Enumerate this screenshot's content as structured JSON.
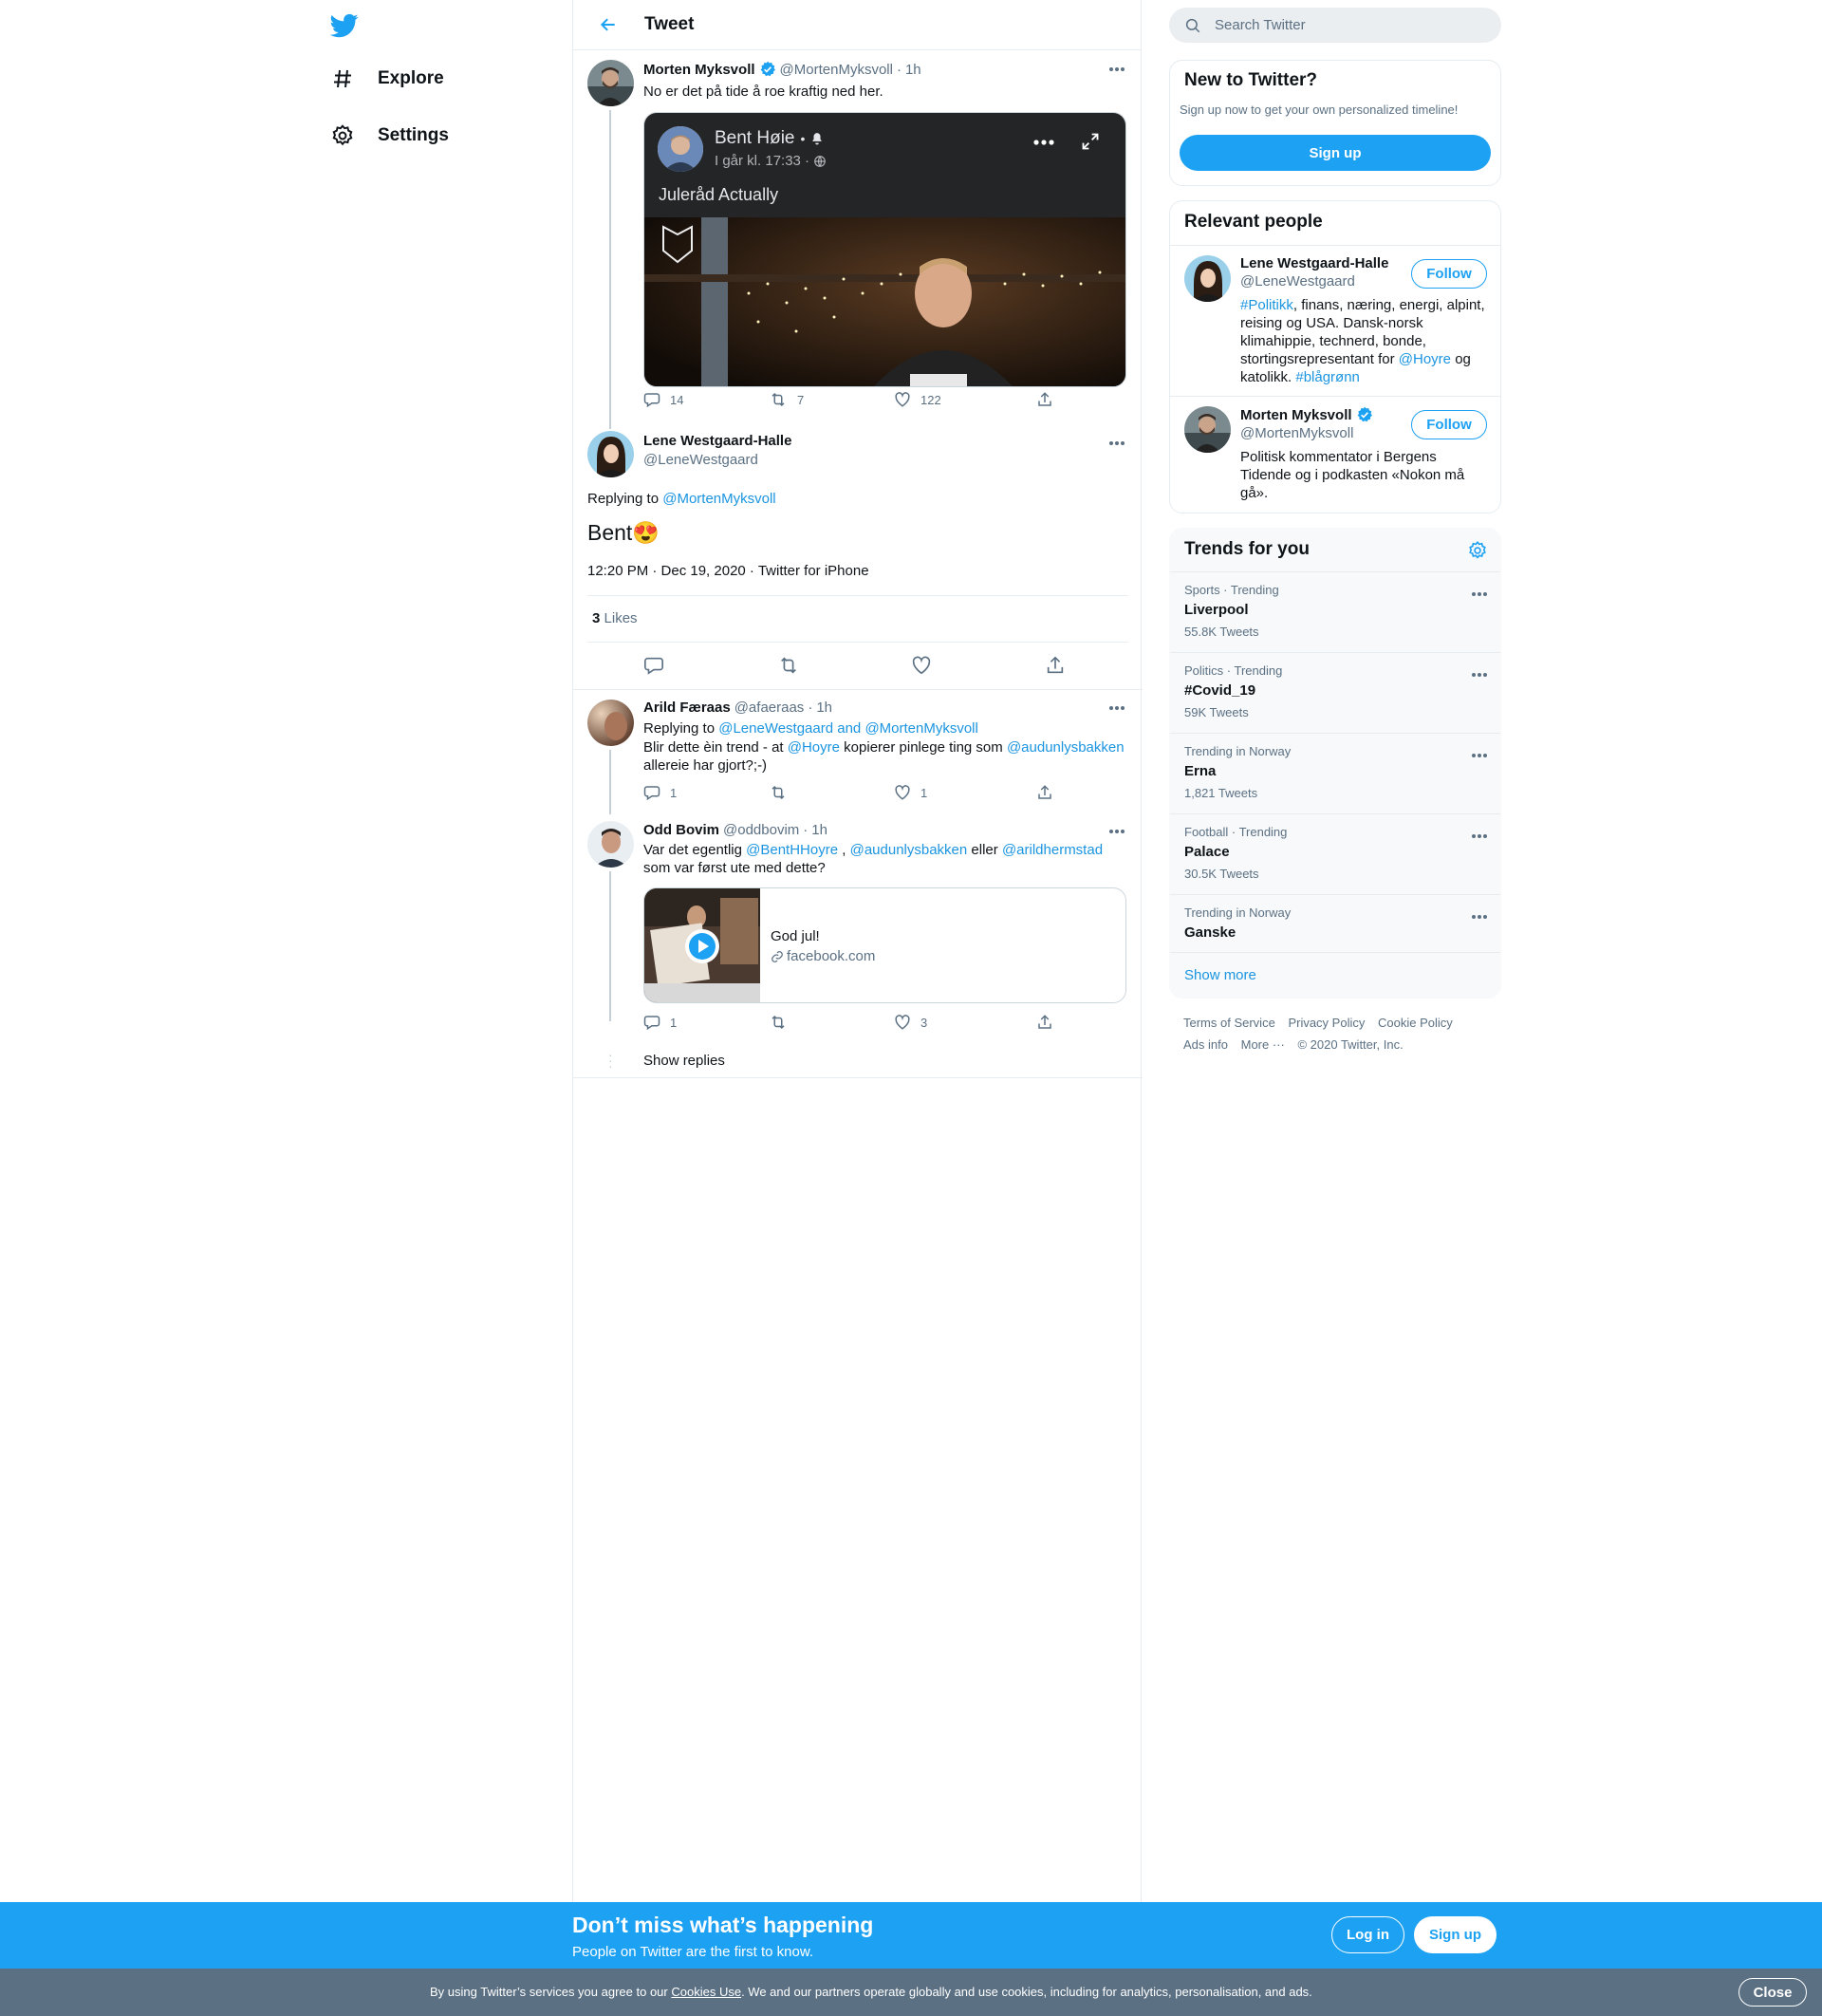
{
  "nav": {
    "explore": "Explore",
    "settings": "Settings"
  },
  "header": {
    "title": "Tweet"
  },
  "thread": {
    "parent": {
      "name": "Morten Myksvoll",
      "handle": "@MortenMyksvoll",
      "sep": "·",
      "time": "1h",
      "text": "No er det på tide å roe kraftig ned her.",
      "media": {
        "poster_name": "Bent Høie",
        "poster_meta": "I går kl. 17:33 ·",
        "caption": "Juleråd Actually"
      },
      "replies": "14",
      "retweets": "7",
      "likes": "122"
    },
    "main": {
      "name": "Lene Westgaard-Halle",
      "handle": "@LeneWestgaard",
      "replying_prefix": "Replying to",
      "replying_to": "@MortenMyksvoll",
      "text": "Bent😍",
      "timestamp": "12:20 PM · Dec 19, 2020 · Twitter for iPhone",
      "likes_count": "3",
      "likes_label": "Likes"
    },
    "replies": [
      {
        "name": "Arild Færaas",
        "handle": "@afaeraas",
        "sep": "·",
        "time": "1h",
        "replying_prefix": "Replying to",
        "replying_to": "@LeneWestgaard and @MortenMyksvoll",
        "text_a": "Blir dette èin trend -  at",
        "mention_a": "@Hoyre",
        "text_b": "kopierer pinlege ting som",
        "mention_b": "@audunlysbakken",
        "text_c": "allereie har gjort?;-)",
        "replies": "1",
        "retweets": "",
        "likes": "1"
      },
      {
        "name": "Odd Bovim",
        "handle": "@oddbovim",
        "sep": "·",
        "time": "1h",
        "text_a": "Var det egentlig",
        "mention_a": "@BentHHoyre",
        "text_b": ",",
        "mention_b": "@audunlysbakken",
        "text_c": "eller",
        "mention_c": "@arildhermstad",
        "text_d": "som var først ute med dette?",
        "card_title": "God jul!",
        "card_domain": "facebook.com",
        "replies": "1",
        "retweets": "",
        "likes": "3"
      }
    ],
    "show_replies": "Show replies"
  },
  "sidebar": {
    "search_placeholder": "Search Twitter",
    "new_to_twitter": {
      "title": "New to Twitter?",
      "subtitle": "Sign up now to get your own personalized timeline!",
      "button": "Sign up"
    },
    "relevant_people": {
      "title": "Relevant people",
      "people": [
        {
          "name": "Lene Westgaard-Halle",
          "handle": "@LeneWestgaard",
          "follow": "Follow",
          "bio_tag": "#Politikk",
          "bio_a": ", finans, næring, energi, alpint, reising og USA. Dansk-norsk klimahippie, technerd, bonde, stortingsrepresentant for",
          "bio_mention": "@Hoyre",
          "bio_b": "og katolikk.",
          "bio_tag2": "#blågrønn"
        },
        {
          "name": "Morten Myksvoll",
          "handle": "@MortenMyksvoll",
          "follow": "Follow",
          "bio": "Politisk kommentator i Bergens Tidende og i podkasten «Nokon må gå»."
        }
      ]
    },
    "trends": {
      "title": "Trends for you",
      "items": [
        {
          "category": "Sports · Trending",
          "name": "Liverpool",
          "count": "55.8K Tweets"
        },
        {
          "category": "Politics · Trending",
          "name": "#Covid_19",
          "count": "59K Tweets"
        },
        {
          "category": "Trending in Norway",
          "name": "Erna",
          "count": "1,821 Tweets"
        },
        {
          "category": "Football · Trending",
          "name": "Palace",
          "count": "30.5K Tweets"
        },
        {
          "category": "Trending in Norway",
          "name": "Ganske",
          "count": ""
        }
      ],
      "show_more": "Show more"
    },
    "footer": {
      "terms": "Terms of Service",
      "privacy": "Privacy Policy",
      "cookie": "Cookie Policy",
      "ads": "Ads info",
      "more": "More ···",
      "copyright": "© 2020 Twitter, Inc."
    }
  },
  "banner": {
    "title": "Don’t miss what’s happening",
    "subtitle": "People on Twitter are the first to know.",
    "login": "Log in",
    "signup": "Sign up"
  },
  "cookie_bar": {
    "text_a": "By using Twitter’s services you agree to our",
    "link": "Cookies Use",
    "text_b": ". We and our partners operate globally and use cookies, including for analytics, personalisation, and ads.",
    "close": "Close"
  },
  "colors": {
    "accent": "#1da1f2",
    "link": "#1b95e0",
    "muted": "#5b7083",
    "border": "#e6ecf0",
    "cookie_bar": "#5b7083"
  },
  "icons": [
    "twitter-logo-icon",
    "hashtag-icon",
    "gear-icon",
    "back-arrow-icon",
    "verified-badge-icon",
    "more-icon",
    "reply-icon",
    "retweet-icon",
    "like-icon",
    "share-icon",
    "search-icon",
    "play-icon",
    "link-icon",
    "bell-icon",
    "globe-icon",
    "expand-icon"
  ]
}
